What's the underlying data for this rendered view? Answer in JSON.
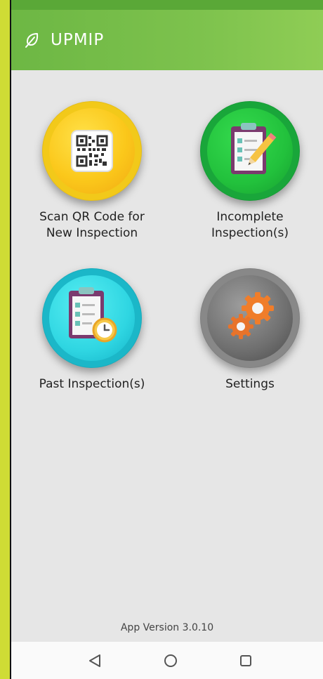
{
  "app": {
    "title": "UPMIP",
    "logo_icon": "leaf-icon",
    "accent_color": "#7dc24d"
  },
  "tiles": [
    {
      "id": "scan",
      "label": "Scan QR Code for\nNew Inspection",
      "icon": "qr-code-icon",
      "color": "#fbc81b"
    },
    {
      "id": "incomplete",
      "label": "Incomplete\nInspection(s)",
      "icon": "clipboard-pencil-icon",
      "color": "#22c13c"
    },
    {
      "id": "past",
      "label": "Past Inspection(s)",
      "icon": "clipboard-clock-icon",
      "color": "#2fd6e2"
    },
    {
      "id": "settings",
      "label": "Settings",
      "icon": "gears-icon",
      "color": "#6f6f6f"
    }
  ],
  "footer": {
    "version": "App Version 3.0.10"
  },
  "navbar": {
    "back_icon": "back-triangle-icon",
    "home_icon": "home-circle-icon",
    "recents_icon": "recents-square-icon"
  }
}
